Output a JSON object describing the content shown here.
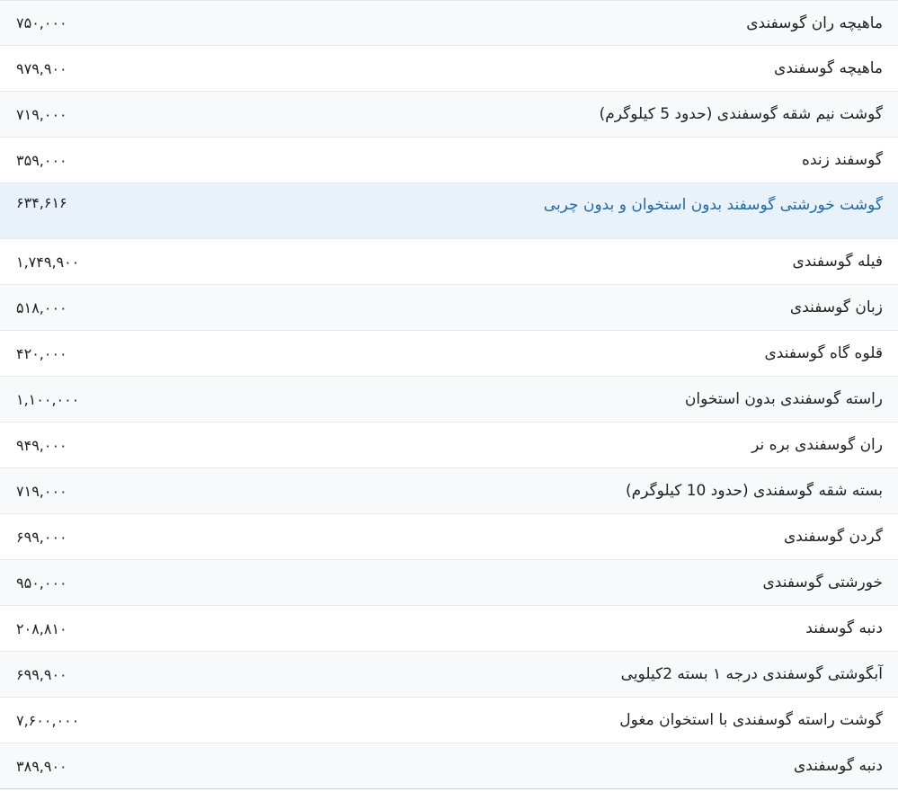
{
  "rows": [
    {
      "name": "ماهیچه ران گوسفندی",
      "price": "۷۵۰,۰۰۰"
    },
    {
      "name": "ماهیچه گوسفندی",
      "price": "۹۷۹,۹۰۰"
    },
    {
      "name": "گوشت نیم شقه گوسفندی (حدود 5 کیلوگرم)",
      "price": "۷۱۹,۰۰۰"
    },
    {
      "name": "گوسفند زنده",
      "price": "۳۵۹,۰۰۰"
    },
    {
      "name": "گوشت خورشتی گوسفند بدون استخوان و بدون چربی",
      "price": "۶۳۴,۶۱۶"
    },
    {
      "name": "فیله گوسفندی",
      "price": "۱,۷۴۹,۹۰۰"
    },
    {
      "name": "زبان گوسفندی",
      "price": "۵۱۸,۰۰۰"
    },
    {
      "name": "قلوه گاه گوسفندی",
      "price": "۴۲۰,۰۰۰"
    },
    {
      "name": "راسته گوسفندی بدون استخوان",
      "price": "۱,۱۰۰,۰۰۰"
    },
    {
      "name": "ران گوسفندی بره نر",
      "price": "۹۴۹,۰۰۰"
    },
    {
      "name": "بسته شقه گوسفندی (حدود 10 کیلوگرم)",
      "price": "۷۱۹,۰۰۰"
    },
    {
      "name": "گردن گوسفندی",
      "price": "۶۹۹,۰۰۰"
    },
    {
      "name": "خورشتی گوسفندی",
      "price": "۹۵۰,۰۰۰"
    },
    {
      "name": "دنبه گوسفند",
      "price": "۲۰۸,۸۱۰"
    },
    {
      "name": "آبگوشتی گوسفندی درجه ۱ بسته 2کیلویی",
      "price": "۶۹۹,۹۰۰"
    },
    {
      "name": "گوشت راسته گوسفندی با استخوان مغول",
      "price": "۷,۶۰۰,۰۰۰"
    },
    {
      "name": "دنبه گوسفندی",
      "price": "۳۸۹,۹۰۰"
    }
  ]
}
